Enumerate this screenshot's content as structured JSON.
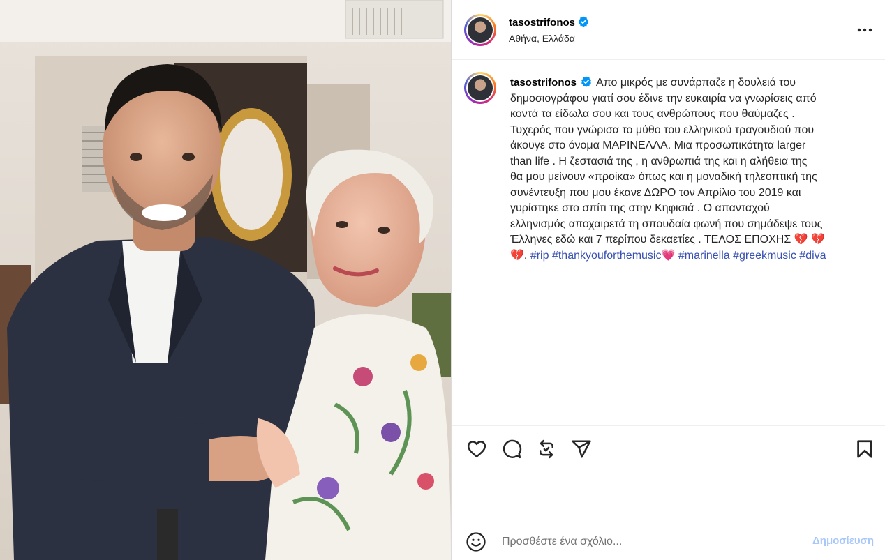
{
  "post": {
    "username": "tasostrifonos",
    "location": "Αθήνα, Ελλάδα",
    "caption_text": "Απο μικρός με συνάρπαζε η δουλειά του\nδημοσιογράφου γιατί σου έδινε την ευκαιρία να γνωρίσεις από\nκοντά τα είδωλα σου και τους ανθρώπους που θαύμαζες .\nΤυχερός που γνώρισα το μύθο του ελληνικού τραγουδιού που\nάκουγε στο όνομα ΜΑΡΙΝΕΛΛΑ. Μια προσωπικότητα larger\nthan life . Η ζεστασιά της , η ανθρωπιά της και η αλήθεια της\nθα μου μείνουν «προίκα» όπως και η μοναδική τηλεοπτική της\nσυνέντευξη που μου έκανε ΔΩΡΟ τον Απρίλιο του 2019 και\nγυρίστηκε στο σπίτι της στην Κηφισιά . Ο απανταχού\nελληνισμός αποχαιρετά τη σπουδαία φωνή που σημάδεψε τους\nΈλληνες εδώ και 7 περίπου δεκαετίες . ΤΕΛΟΣ ΕΠΟΧΗΣ 💔 💔\n💔. ",
    "hashtags": [
      "#rip",
      "#thankyouforthemusic"
    ],
    "heart_emoji": "💗",
    "hashtags_after": [
      "#marinella",
      "#greekmusic",
      "#diva"
    ]
  },
  "comment": {
    "placeholder": "Προσθέστε ένα σχόλιο...",
    "post_label": "Δημοσίευση"
  },
  "icons": {
    "like": "heart-icon",
    "comment": "comment-icon",
    "repost": "repost-icon",
    "share": "share-icon",
    "save": "bookmark-icon",
    "verified": "verified-badge-icon",
    "more": "more-options-icon",
    "emoji": "emoji-icon"
  },
  "colors": {
    "verified": "#0095f6",
    "hashtag": "#3850b0",
    "post_button": "#a8c7fa"
  }
}
